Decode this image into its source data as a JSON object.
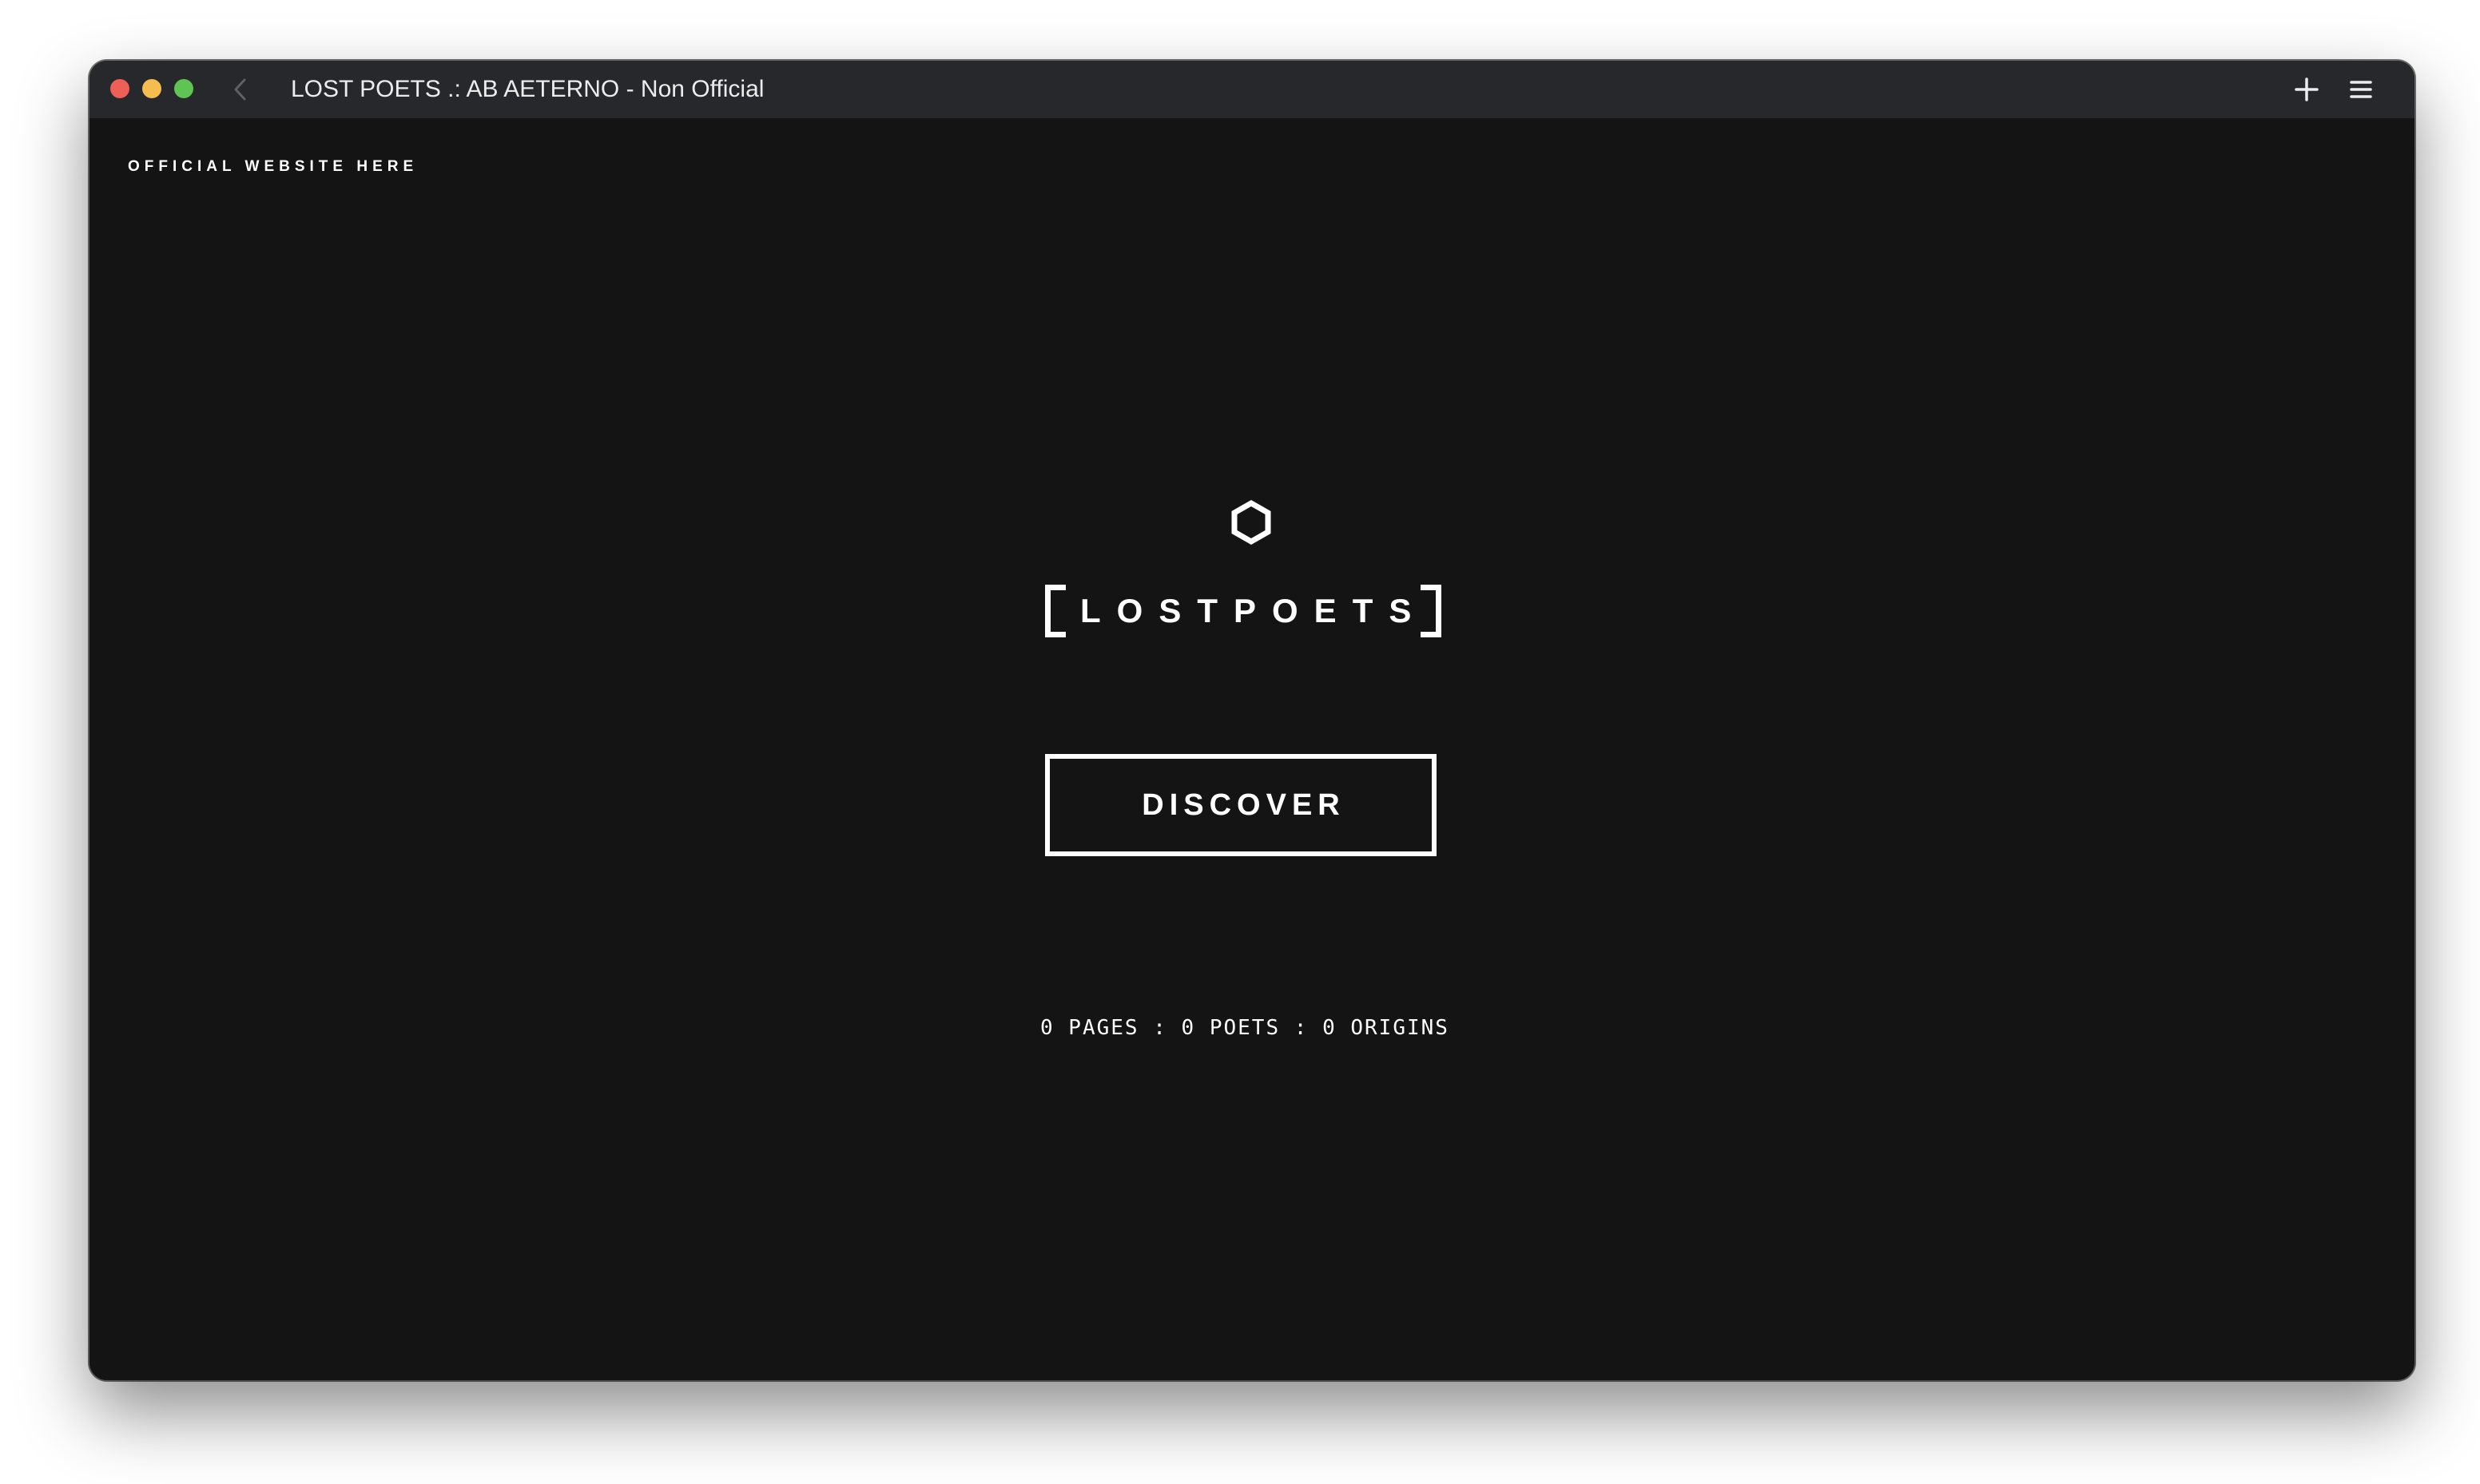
{
  "window": {
    "title": "LOST POETS .: AB AETERNO - Non Official"
  },
  "toolbar": {
    "back_icon": "chevron-left-icon",
    "plus_icon": "plus-icon",
    "menu_icon": "hamburger-menu-icon"
  },
  "page": {
    "official_link": "OFFICIAL WEBSITE HERE",
    "logo_icon": "hexagon-icon",
    "logo_text": "LOSTPOETS",
    "discover_label": "DISCOVER",
    "stats_text": "0 PAGES : 0 POETS : 0 ORIGINS"
  },
  "colors": {
    "background": "#141415",
    "titlebar": "#27282c",
    "foreground": "#ffffff",
    "close": "#ee5f57",
    "minimize": "#f5bd4f",
    "maximize": "#5fc454"
  }
}
